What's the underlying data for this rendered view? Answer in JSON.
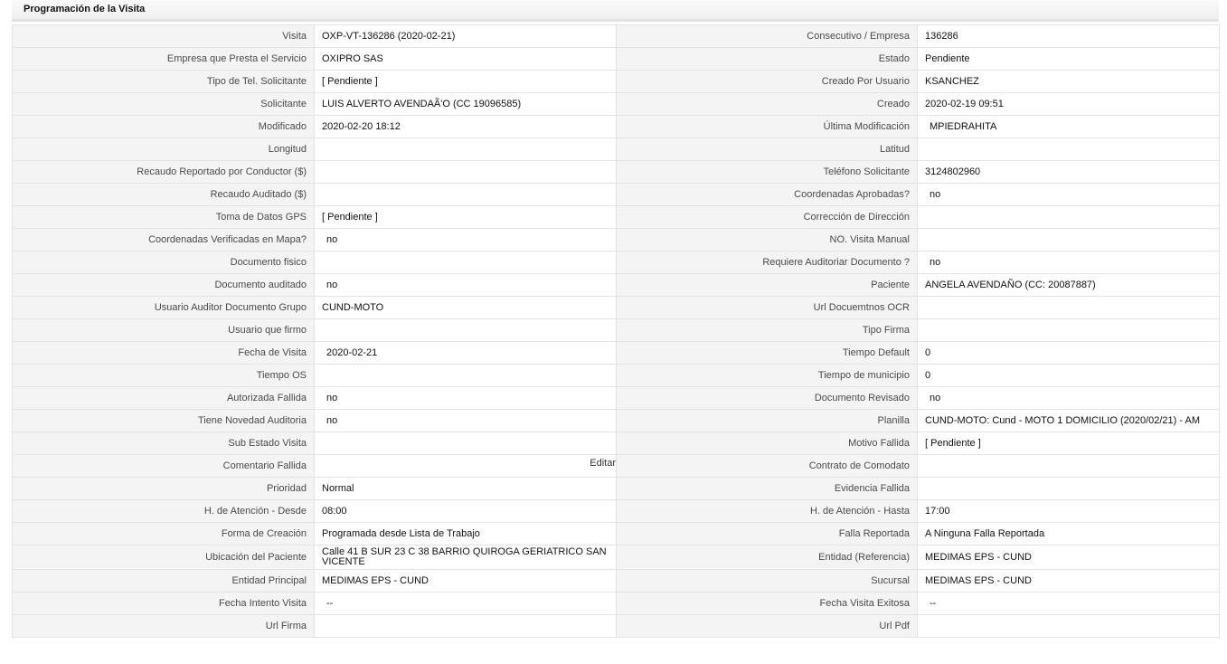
{
  "panel": {
    "title": "Programación de la Visita"
  },
  "rows": [
    [
      {
        "label": "Visita",
        "value": "OXP-VT-136286 (2020-02-21)"
      },
      {
        "label": "Consecutivo / Empresa",
        "value": "136286"
      }
    ],
    [
      {
        "label": "Empresa que Presta el Servicio",
        "value": "OXIPRO SAS"
      },
      {
        "label": "Estado",
        "value": "Pendiente"
      }
    ],
    [
      {
        "label": "Tipo de Tel. Solicitante",
        "value": "[ Pendiente ]"
      },
      {
        "label": "Creado Por Usuario",
        "value": "KSANCHEZ"
      }
    ],
    [
      {
        "label": "Solicitante",
        "value": "LUIS ALVERTO AVENDAÃ'O (CC 19096585)"
      },
      {
        "label": "Creado",
        "value": "2020-02-19 09:51"
      }
    ],
    [
      {
        "label": "Modificado",
        "value": "2020-02-20 18:12"
      },
      {
        "label": "Última Modificación",
        "value": "MPIEDRAHITA"
      }
    ],
    [
      {
        "label": "Longitud",
        "value": ""
      },
      {
        "label": "Latitud",
        "value": ""
      }
    ],
    [
      {
        "label": "Recaudo Reportado por Conductor ($)",
        "value": ""
      },
      {
        "label": "Teléfono Solicitante",
        "value": "3124802960"
      }
    ],
    [
      {
        "label": "Recaudo Auditado ($)",
        "value": ""
      },
      {
        "label": "Coordenadas Aprobadas?",
        "value": "no"
      }
    ],
    [
      {
        "label": "Toma de Datos GPS",
        "value": "[ Pendiente ]"
      },
      {
        "label": "Corrección de Dirección",
        "value": ""
      }
    ],
    [
      {
        "label": "Coordenadas Verificadas en Mapa?",
        "value": "no"
      },
      {
        "label": "NO. Visita Manual",
        "value": ""
      }
    ],
    [
      {
        "label": "Documento fisico",
        "value": ""
      },
      {
        "label": "Requiere Auditoriar Documento ?",
        "value": "no"
      }
    ],
    [
      {
        "label": "Documento auditado",
        "value": "no"
      },
      {
        "label": "Paciente",
        "value": "ANGELA AVENDAÑO (CC: 20087887)"
      }
    ],
    [
      {
        "label": "Usuario Auditor Documento Grupo",
        "value": "CUND-MOTO"
      },
      {
        "label": "Url Docuemtnos OCR",
        "value": ""
      }
    ],
    [
      {
        "label": "Usuario que firmo",
        "value": ""
      },
      {
        "label": "Tipo Firma",
        "value": ""
      }
    ],
    [
      {
        "label": "Fecha de Visita",
        "value": "2020-02-21"
      },
      {
        "label": "Tiempo Default",
        "value": "0"
      }
    ],
    [
      {
        "label": "Tiempo OS",
        "value": ""
      },
      {
        "label": "Tiempo de municipio",
        "value": "0"
      }
    ],
    [
      {
        "label": "Autorizada Fallida",
        "value": "no"
      },
      {
        "label": "Documento Revisado",
        "value": "no"
      }
    ],
    [
      {
        "label": "Tiene Novedad Auditoria",
        "value": "no"
      },
      {
        "label": "Planilla",
        "value": "CUND-MOTO: Cund - MOTO 1 DOMICILIO (2020/02/21) - AM"
      }
    ],
    [
      {
        "label": "Sub Estado Visita",
        "value": ""
      },
      {
        "label": "Motivo Fallida",
        "value": "[ Pendiente ]"
      }
    ],
    [
      {
        "label": "Comentario Fallida",
        "value": "",
        "action": "Editar"
      },
      {
        "label": "Contrato de Comodato",
        "value": ""
      }
    ],
    [
      {
        "label": "Prioridad",
        "value": "Normal"
      },
      {
        "label": "Evidencia Fallida",
        "value": ""
      }
    ],
    [
      {
        "label": "H. de Atención - Desde",
        "value": "08:00"
      },
      {
        "label": "H. de Atención - Hasta",
        "value": "17:00"
      }
    ],
    [
      {
        "label": "Forma de Creación",
        "value": "Programada desde Lista de Trabajo"
      },
      {
        "label": "Falla Reportada",
        "value": "A Ninguna Falla Reportada"
      }
    ],
    [
      {
        "label": "Ubicación del Paciente",
        "value": "Calle 41 B SUR 23 C 38 BARRIO QUIROGA GERIATRICO SAN VICENTE"
      },
      {
        "label": "Entidad (Referencia)",
        "value": "MEDIMAS EPS - CUND"
      }
    ],
    [
      {
        "label": "Entidad Principal",
        "value": "MEDIMAS EPS - CUND"
      },
      {
        "label": "Sucursal",
        "value": "MEDIMAS EPS - CUND"
      }
    ],
    [
      {
        "label": "Fecha Intento Visita",
        "value": "--"
      },
      {
        "label": "Fecha Visita Exitosa",
        "value": "--"
      }
    ],
    [
      {
        "label": "Url Firma",
        "value": ""
      },
      {
        "label": "Url Pdf",
        "value": ""
      }
    ]
  ]
}
